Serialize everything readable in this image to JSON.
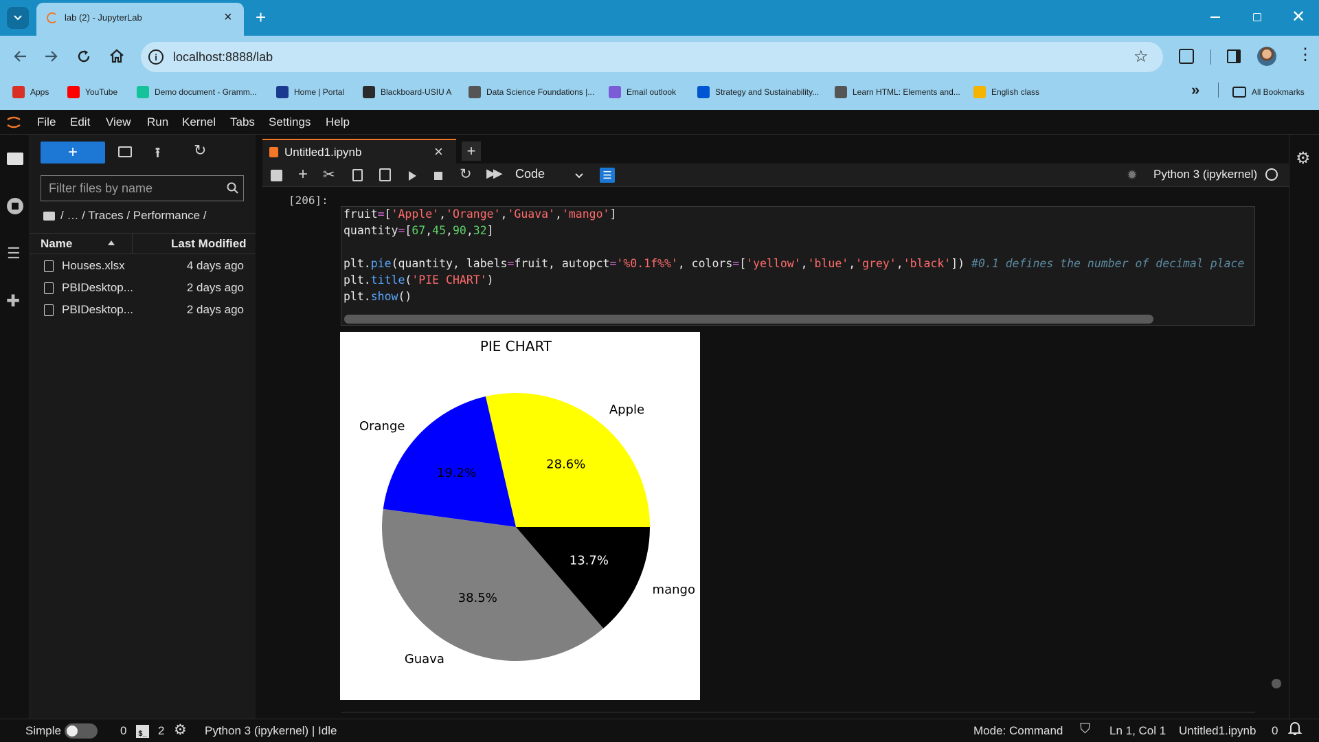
{
  "browser": {
    "tab_title": "lab (2) - JupyterLab",
    "url": "localhost:8888/lab",
    "bookmarks": [
      {
        "label": "Apps",
        "icon": "apps-grid-icon",
        "color": "#d93025"
      },
      {
        "label": "YouTube",
        "icon": "youtube-icon",
        "color": "#ff0000"
      },
      {
        "label": "Demo document - Gramm...",
        "icon": "grammarly-icon",
        "color": "#15c39a"
      },
      {
        "label": "Home | Portal",
        "icon": "portal-icon",
        "color": "#1a3a8f"
      },
      {
        "label": "Blackboard-USIU A",
        "icon": "blackboard-icon",
        "color": "#2b2b2b"
      },
      {
        "label": "Data Science Foundations |...",
        "icon": "page-icon",
        "color": "#555555"
      },
      {
        "label": "Email outlook",
        "icon": "outlook-icon",
        "color": "#7b5cd6"
      },
      {
        "label": "Strategy and Sustainability...",
        "icon": "coursera-icon",
        "color": "#0056d2"
      },
      {
        "label": "Learn HTML: Elements and...",
        "icon": "page-icon",
        "color": "#555555"
      },
      {
        "label": "English class",
        "icon": "classroom-icon",
        "color": "#f4b400"
      }
    ],
    "all_bookmarks": "All Bookmarks"
  },
  "menubar": [
    "File",
    "Edit",
    "View",
    "Run",
    "Kernel",
    "Tabs",
    "Settings",
    "Help"
  ],
  "filebrowser": {
    "new_label": "+",
    "filter_placeholder": "Filter files by name",
    "breadcrumb": "/   …  / Traces / Performance /",
    "col_name": "Name",
    "col_modified": "Last Modified",
    "files": [
      {
        "name": "Houses.xlsx",
        "modified": "4 days ago"
      },
      {
        "name": "PBIDesktop...",
        "modified": "2 days ago"
      },
      {
        "name": "PBIDesktop...",
        "modified": "2 days ago"
      }
    ]
  },
  "notebook": {
    "tab_name": "Untitled1.ipynb",
    "cell_type": "Code",
    "kernel": "Python 3 (ipykernel)",
    "prompt": "[206]:",
    "code": [
      "fruit=['Apple','Orange','Guava','mango']",
      "quantity=[67,45,90,32]",
      "",
      "plt.pie(quantity, labels=fruit, autopct='%0.1f%%', colors=['yellow','blue','grey','black']) #0.1 defines the number of decimal place",
      "plt.title('PIE CHART')",
      "plt.show()"
    ]
  },
  "chart_data": {
    "type": "pie",
    "title": "PIE CHART",
    "categories": [
      "Apple",
      "Orange",
      "Guava",
      "mango"
    ],
    "values": [
      67,
      45,
      90,
      32
    ],
    "percent_labels": [
      "28.6%",
      "19.2%",
      "38.5%",
      "13.7%"
    ],
    "colors": [
      "#ffff00",
      "#0000ff",
      "#808080",
      "#000000"
    ],
    "start_angle_deg": 0,
    "direction": "counterclockwise"
  },
  "statusbar": {
    "mode_label": "Simple",
    "terminals": "0",
    "kernels": "2",
    "kernel_status": "Python 3 (ipykernel) | Idle",
    "mode": "Mode: Command",
    "position": "Ln 1, Col 1",
    "file": "Untitled1.ipynb",
    "notifications": "0"
  }
}
